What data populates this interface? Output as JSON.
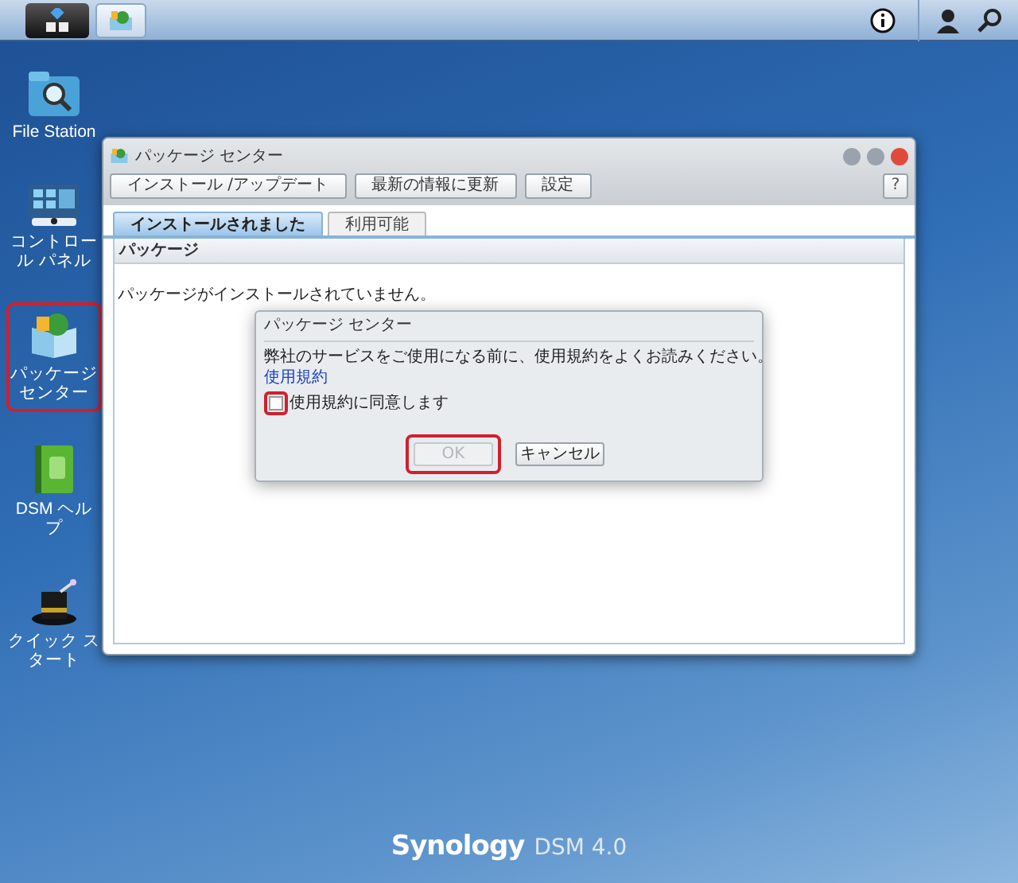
{
  "desktop_icons": [
    {
      "kind": "folder",
      "label": "File Station",
      "highlighted": false
    },
    {
      "kind": "panel",
      "label": "コントロール パネル",
      "highlighted": false
    },
    {
      "kind": "package",
      "label": "パッケージセンター",
      "highlighted": true
    },
    {
      "kind": "book",
      "label": "DSM ヘルプ",
      "highlighted": false
    },
    {
      "kind": "hat",
      "label": "クイック スタート",
      "highlighted": false
    }
  ],
  "window": {
    "title": "パッケージ センター",
    "toolbar": [
      "インストール /アップデート",
      "最新の情報に更新",
      "設定"
    ],
    "help": "?",
    "tabs": [
      {
        "label": "インストールされました",
        "selected": true
      },
      {
        "label": "利用可能",
        "selected": false
      }
    ],
    "grid_header": "パッケージ",
    "empty_message": "パッケージがインストールされていません。"
  },
  "dialog": {
    "title": "パッケージ センター",
    "message": "弊社のサービスをご使用になる前に、使用規約をよくお読みください。",
    "link": "使用規約",
    "checkbox": {
      "label": "使用規約に同意します",
      "checked": false,
      "highlighted": true
    },
    "buttons": [
      {
        "label": "OK",
        "disabled": true,
        "highlighted": true
      },
      {
        "label": "キャンセル",
        "disabled": false,
        "highlighted": false
      }
    ]
  },
  "logo": {
    "brand": "Synology",
    "product": "DSM 4.0"
  }
}
